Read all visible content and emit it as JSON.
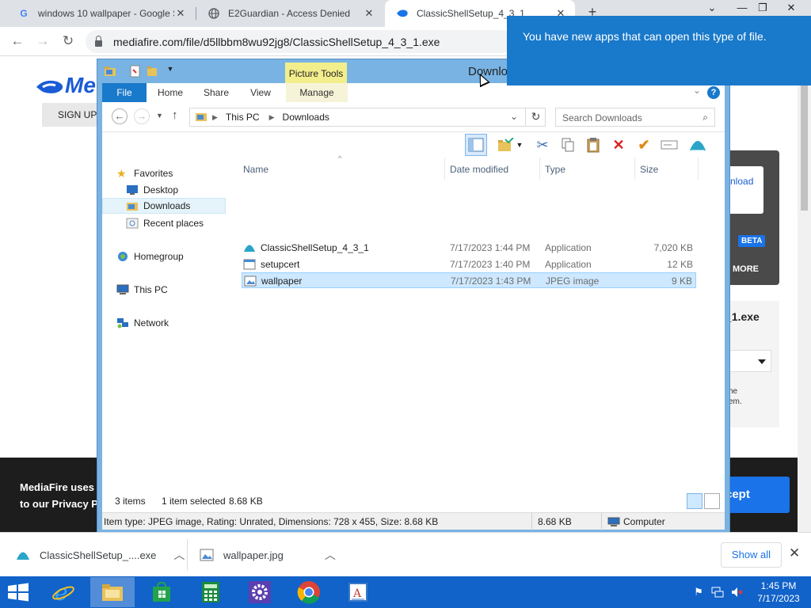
{
  "browser": {
    "tabs": [
      {
        "title": "windows 10 wallpaper - Google S",
        "icon": "google-icon"
      },
      {
        "title": "E2Guardian - Access Denied",
        "icon": "globe-icon"
      },
      {
        "title": "ClassicShellSetup_4_3_1",
        "icon": "mediafire-icon"
      }
    ],
    "url": "mediafire.com/file/d5llbbm8wu92jg8/ClassicShellSetup_4_3_1.exe"
  },
  "page": {
    "logo": "Me",
    "signup": "SIGN UP",
    "download_btn": "nload",
    "beta": "BETA",
    "learn_more": "N MORE",
    "file_label": "_1.exe",
    "small_text_1": "he",
    "small_text_2": "em.",
    "cookie_line1": "MediaFire uses c",
    "cookie_line2": "to our Privacy Po",
    "accept": "cept"
  },
  "toast": {
    "message": "You have new apps that can open this type of file."
  },
  "explorer": {
    "title": "Downlo",
    "picture_tools": "Picture Tools",
    "ribbon_tabs": [
      "File",
      "Home",
      "Share",
      "View",
      "Manage"
    ],
    "breadcrumb": [
      "This PC",
      "Downloads"
    ],
    "search_placeholder": "Search Downloads",
    "nav": {
      "favorites": "Favorites",
      "desktop": "Desktop",
      "downloads": "Downloads",
      "recent": "Recent places",
      "homegroup": "Homegroup",
      "this_pc": "This PC",
      "network": "Network"
    },
    "columns": [
      "Name",
      "Date modified",
      "Type",
      "Size"
    ],
    "files": [
      {
        "name": "ClassicShellSetup_4_3_1",
        "date": "7/17/2023 1:44 PM",
        "type": "Application",
        "size": "7,020 KB"
      },
      {
        "name": "setupcert",
        "date": "7/17/2023 1:40 PM",
        "type": "Application",
        "size": "12 KB"
      },
      {
        "name": "wallpaper",
        "date": "7/17/2023 1:43 PM",
        "type": "JPEG image",
        "size": "9 KB"
      }
    ],
    "status": {
      "items": "3 items",
      "selected": "1 item selected",
      "selected_size": "8.68 KB"
    },
    "details": {
      "text": "Item type: JPEG image, Rating: Unrated, Dimensions: 728 x 455, Size: 8.68 KB",
      "size": "8.68 KB",
      "location": "Computer"
    }
  },
  "downloads_shelf": {
    "items": [
      "ClassicShellSetup_....exe",
      "wallpaper.jpg"
    ],
    "show_all": "Show all"
  },
  "taskbar": {
    "time": "1:45 PM",
    "date": "7/17/2023"
  },
  "colors": {
    "accent_blue": "#1979ca",
    "taskbar": "#1162c9",
    "picture_tools": "#f3ee8c",
    "selection": "#cde8ff"
  }
}
